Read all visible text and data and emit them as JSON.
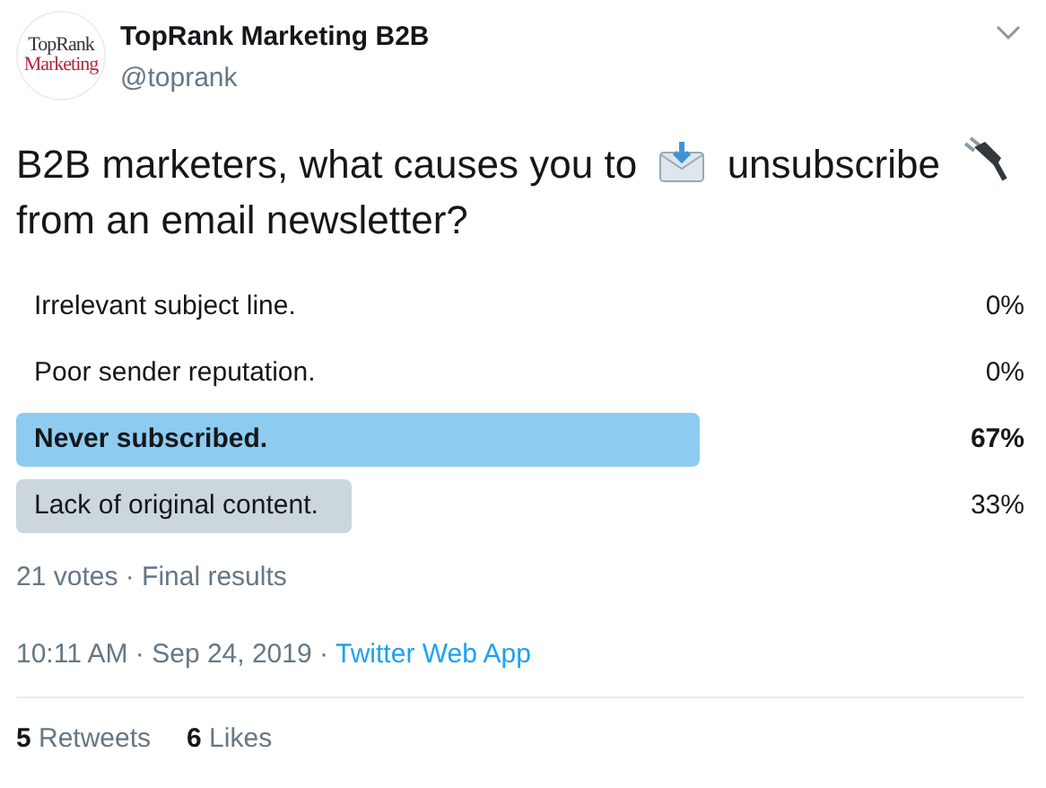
{
  "author": {
    "logo_lines": [
      "TopRank",
      "Marketing"
    ],
    "name": "TopRank Marketing B2B",
    "handle": "@toprank"
  },
  "tweet": {
    "parts": [
      {
        "kind": "text",
        "text": "B2B marketers, what causes you to"
      },
      {
        "kind": "icon"
      },
      {
        "kind": "text",
        "text": "unsubscribe"
      },
      {
        "kind": "icon"
      },
      {
        "kind": "text",
        "text": "from an email newsletter?"
      }
    ]
  },
  "poll": {
    "options": [
      {
        "label": "Irrelevant subject line.",
        "percent": "0%",
        "selected": false
      },
      {
        "label": "Poor sender reputation.",
        "percent": "0%",
        "selected": false
      },
      {
        "label": "Never subscribed.",
        "percent": "67%",
        "selected": true
      },
      {
        "label": "Lack of original content.",
        "percent": "33%",
        "selected": false
      }
    ],
    "summary": "21 votes · Final results"
  },
  "meta": {
    "time": "10:11 AM · Sep 24, 2019 ·",
    "source": "Twitter Web App"
  },
  "stats": [
    {
      "count": "5",
      "label": "Retweets"
    },
    {
      "count": "6",
      "label": "Likes"
    }
  ]
}
